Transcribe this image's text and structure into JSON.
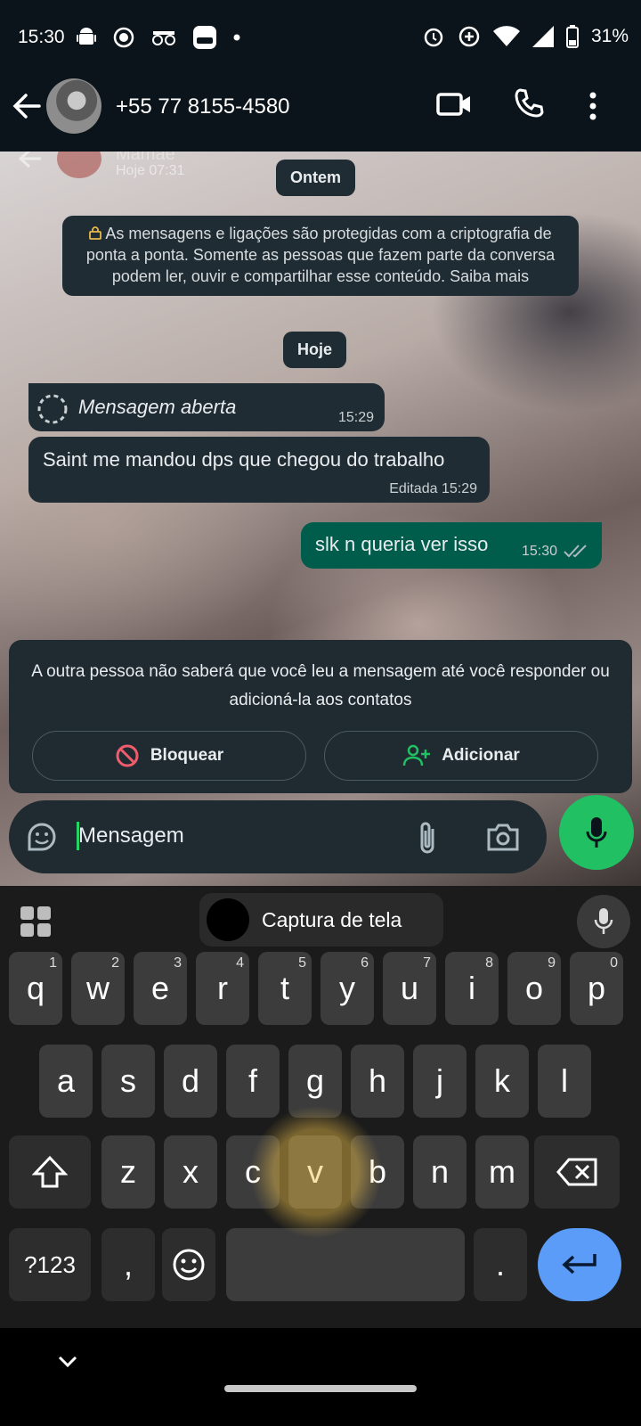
{
  "status_bar": {
    "time": "15:30",
    "battery": "31%"
  },
  "header": {
    "contact": "+55 77 8155-4580"
  },
  "chat": {
    "date_yesterday": "Ontem",
    "encryption_notice": "As mensagens e ligações são protegidas com a criptografia de ponta a ponta. Somente as pessoas que fazem parte da conversa podem ler, ouvir e compartilhar esse conteúdo. Saiba mais",
    "date_today": "Hoje",
    "messages": [
      {
        "direction": "in",
        "text": "Mensagem aberta",
        "time": "15:29"
      },
      {
        "direction": "in",
        "text": "Saint me mandou dps que chegou do trabalho",
        "edited": "Editada",
        "time": "15:29"
      },
      {
        "direction": "out",
        "text": "slk n queria ver isso",
        "time": "15:30"
      }
    ],
    "ghost_story": {
      "name": "Mamãe",
      "time": "Hoje 07:31"
    }
  },
  "unknown_contact": {
    "notice": "A outra pessoa não saberá que você leu a mensagem até você responder ou adicioná-la aos contatos",
    "block_label": "Bloquear",
    "add_label": "Adicionar"
  },
  "composer": {
    "placeholder": "Mensagem"
  },
  "keyboard": {
    "suggestion": "Captura de tela",
    "row1": [
      {
        "k": "q",
        "h": "1"
      },
      {
        "k": "w",
        "h": "2"
      },
      {
        "k": "e",
        "h": "3"
      },
      {
        "k": "r",
        "h": "4"
      },
      {
        "k": "t",
        "h": "5"
      },
      {
        "k": "y",
        "h": "6"
      },
      {
        "k": "u",
        "h": "7"
      },
      {
        "k": "i",
        "h": "8"
      },
      {
        "k": "o",
        "h": "9"
      },
      {
        "k": "p",
        "h": "0"
      }
    ],
    "row2": [
      "a",
      "s",
      "d",
      "f",
      "g",
      "h",
      "j",
      "k",
      "l"
    ],
    "row3": [
      "z",
      "x",
      "c",
      "v",
      "b",
      "n",
      "m"
    ],
    "symbols_label": "?123",
    "comma": ",",
    "period": "."
  },
  "colors": {
    "accent_green": "#21c063",
    "enter_blue": "#5a9cf8",
    "out_bubble": "#005c4b"
  }
}
